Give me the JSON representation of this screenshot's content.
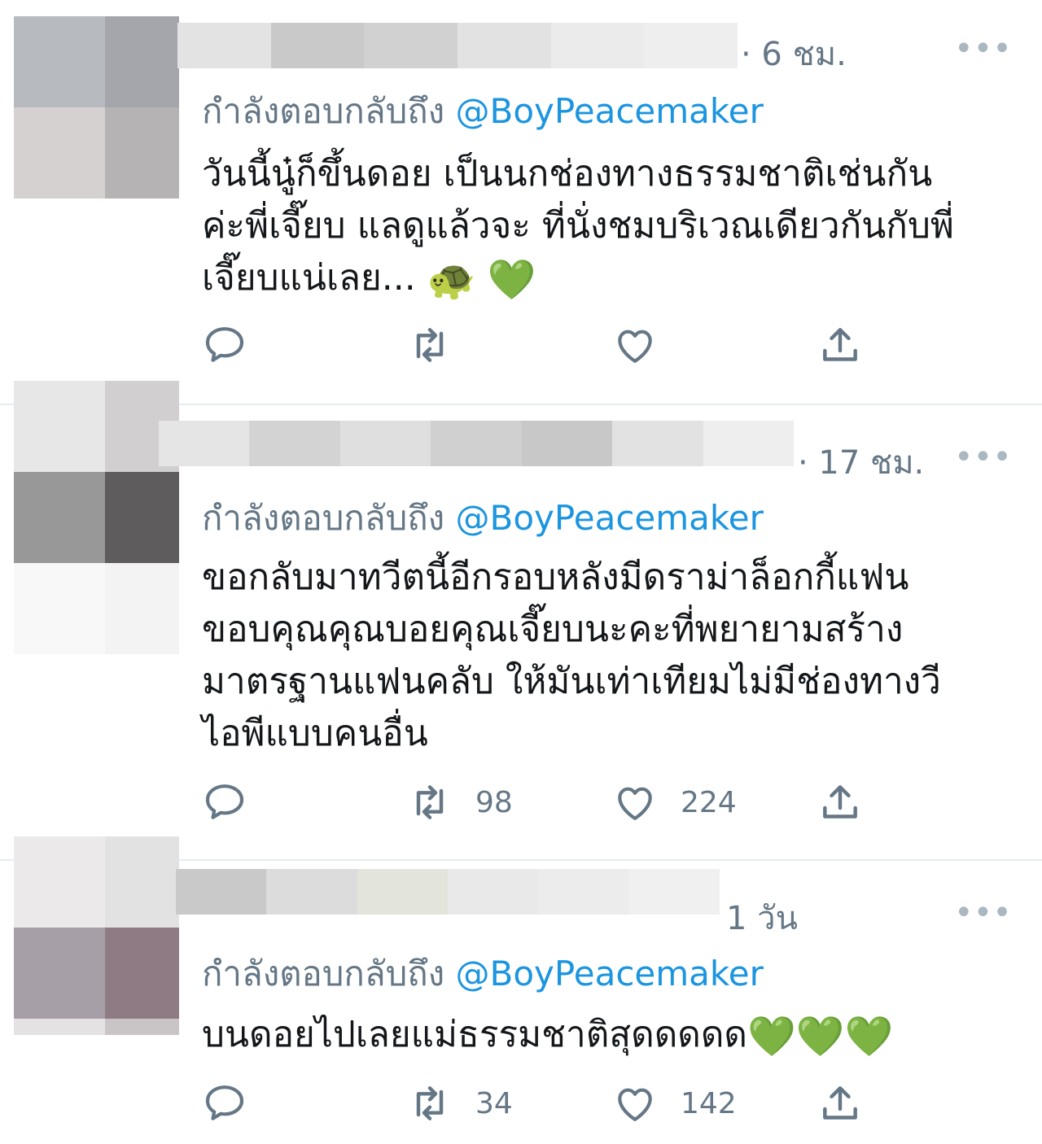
{
  "tweets": [
    {
      "time": "· 6 ชม.",
      "more": "•••",
      "reply_prefix": "กำลังตอบกลับถึง",
      "reply_handle": "@BoyPeacemaker",
      "lines": [
        "วันนี้นู๋ก็ขึ้นดอย เป็นนกช่องทางธรรมชาติเช่นกัน",
        "ค่ะพี่เจี๊ยบ แลดูแล้วจะ ที่นั่งชมบริเวณเดียวกันกับพี่",
        "เจี๊ยบแน่เลย..."
      ],
      "last_line_emoji": [
        "turtle-emoji",
        "green-heart-emoji"
      ],
      "retweets": "",
      "likes": ""
    },
    {
      "time": "· 17 ชม.",
      "more": "•••",
      "reply_prefix": "กำลังตอบกลับถึง",
      "reply_handle": "@BoyPeacemaker",
      "lines": [
        "ขอกลับมาทวีตนี้อีกรอบหลังมีดราม่าล็อกกี้แฟน",
        "ขอบคุณคุณบอยคุณเจี๊ยบนะคะที่พยายามสร้าง",
        "มาตรฐานแฟนคลับ ให้มันเท่าเทียมไม่มีช่องทางวี",
        "ไอพีแบบคนอื่น"
      ],
      "retweets": "98",
      "likes": "224"
    },
    {
      "time": "1 วัน",
      "more": "•••",
      "reply_prefix": "กำลังตอบกลับถึง",
      "reply_handle": "@BoyPeacemaker",
      "lines": [
        "บนดอยไปเลยแม่ธรรมชาติสุดดดดด"
      ],
      "last_line_emoji": [
        "green-heart-emoji",
        "green-heart-emoji",
        "green-heart-emoji"
      ],
      "retweets": "34",
      "likes": "142"
    }
  ],
  "colors": {
    "handle": "#1b95e0",
    "muted": "#657786",
    "divider": "#e6ecf0",
    "green_heart": "#34c134"
  },
  "icons": [
    "reply-icon",
    "retweet-icon",
    "like-icon",
    "share-icon",
    "more-icon"
  ]
}
